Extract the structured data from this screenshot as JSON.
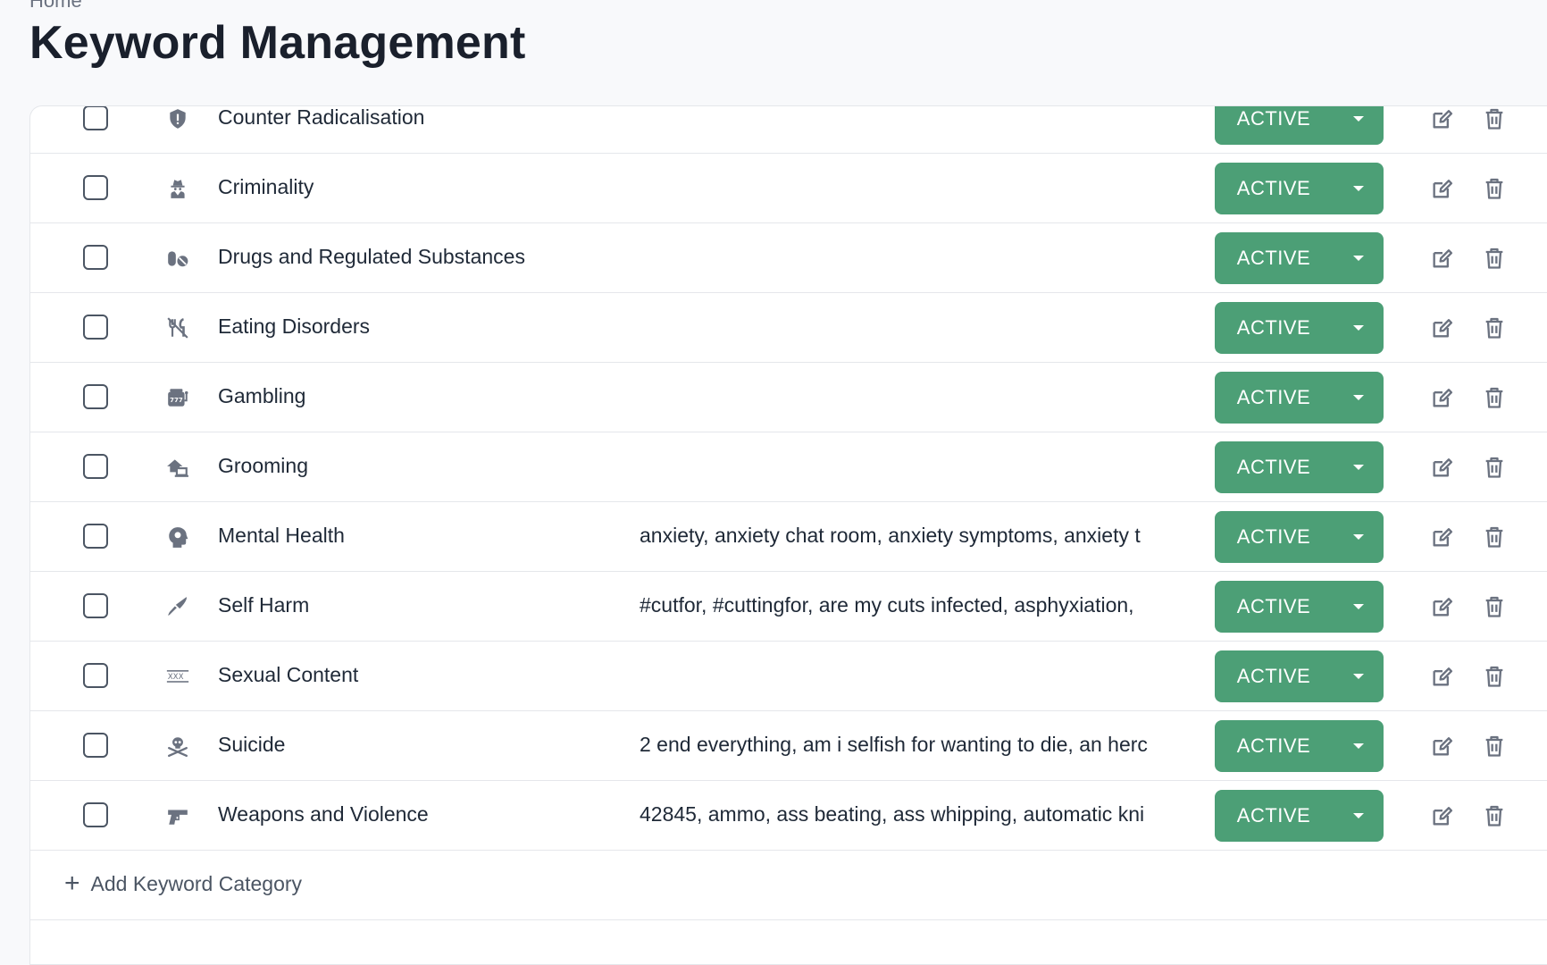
{
  "breadcrumb": "Home",
  "page_title": "Keyword Management",
  "colors": {
    "status_bg": "#4c9f76",
    "icon": "#6b7280"
  },
  "categories": [
    {
      "name": "Counter Radicalisation",
      "icon": "shield-alert-icon",
      "keywords": "",
      "status": "ACTIVE"
    },
    {
      "name": "Criminality",
      "icon": "user-secret-icon",
      "keywords": "",
      "status": "ACTIVE"
    },
    {
      "name": "Drugs and Regulated Substances",
      "icon": "pills-icon",
      "keywords": "",
      "status": "ACTIVE"
    },
    {
      "name": "Eating Disorders",
      "icon": "utensils-slash-icon",
      "keywords": "",
      "status": "ACTIVE"
    },
    {
      "name": "Gambling",
      "icon": "slot-machine-icon",
      "keywords": "",
      "status": "ACTIVE"
    },
    {
      "name": "Grooming",
      "icon": "house-laptop-icon",
      "keywords": "",
      "status": "ACTIVE"
    },
    {
      "name": "Mental Health",
      "icon": "head-brain-icon",
      "keywords": "anxiety, anxiety chat room, anxiety symptoms, anxiety t",
      "status": "ACTIVE"
    },
    {
      "name": "Self Harm",
      "icon": "knife-icon",
      "keywords": "#cutfor, #cuttingfor, are my cuts infected, asphyxiation,",
      "status": "ACTIVE"
    },
    {
      "name": "Sexual Content",
      "icon": "xxx-icon",
      "keywords": "",
      "status": "ACTIVE"
    },
    {
      "name": "Suicide",
      "icon": "skull-crossbones-icon",
      "keywords": "2 end everything, am i selfish for wanting to die, an herc",
      "status": "ACTIVE"
    },
    {
      "name": "Weapons and Violence",
      "icon": "gun-icon",
      "keywords": "42845, ammo, ass beating, ass whipping, automatic kni",
      "status": "ACTIVE"
    }
  ],
  "add_label": "Add Keyword Category"
}
